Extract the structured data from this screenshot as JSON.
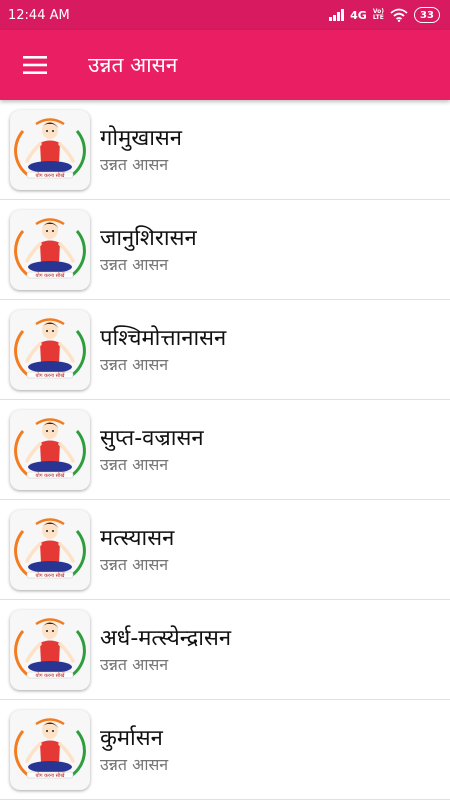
{
  "status": {
    "time": "12:44 AM",
    "network": "4G",
    "volte_top": "Vo)",
    "volte_bottom": "LTE",
    "battery": "33"
  },
  "appbar": {
    "title": "उन्नत आसन"
  },
  "thumbnail_caption": "योग करना सीखें",
  "items": [
    {
      "name": "गोमुखासन",
      "subtitle": "उन्नत आसन"
    },
    {
      "name": "जानुशिरासन",
      "subtitle": "उन्नत आसन"
    },
    {
      "name": "पश्चिमोत्तानासन",
      "subtitle": "उन्नत आसन"
    },
    {
      "name": "सुप्त-वज्रासन",
      "subtitle": "उन्नत आसन"
    },
    {
      "name": "मत्स्यासन",
      "subtitle": "उन्नत आसन"
    },
    {
      "name": "अर्ध-मत्स्येन्द्रासन",
      "subtitle": "उन्नत आसन"
    },
    {
      "name": "कुर्मासन",
      "subtitle": "उन्नत आसन"
    }
  ],
  "colors": {
    "statusbar": "#d81b60",
    "appbar": "#e91e63",
    "accent_saffron": "#f47c20",
    "accent_green": "#2e9e3c"
  }
}
